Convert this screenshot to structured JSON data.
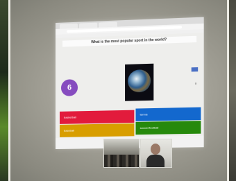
{
  "quiz": {
    "question": "What is the most popular sport in the world?",
    "timer": "6",
    "answers": [
      {
        "text": "basketball",
        "color": "#e21b3c"
      },
      {
        "text": "tennis",
        "color": "#1368ce"
      },
      {
        "text": "baseball",
        "color": "#d89e00"
      },
      {
        "text": "soccer/football",
        "color": "#26890c"
      }
    ],
    "answer_count": "0"
  },
  "colors": {
    "wall": "#a19f95",
    "timer": "#864cbf"
  }
}
